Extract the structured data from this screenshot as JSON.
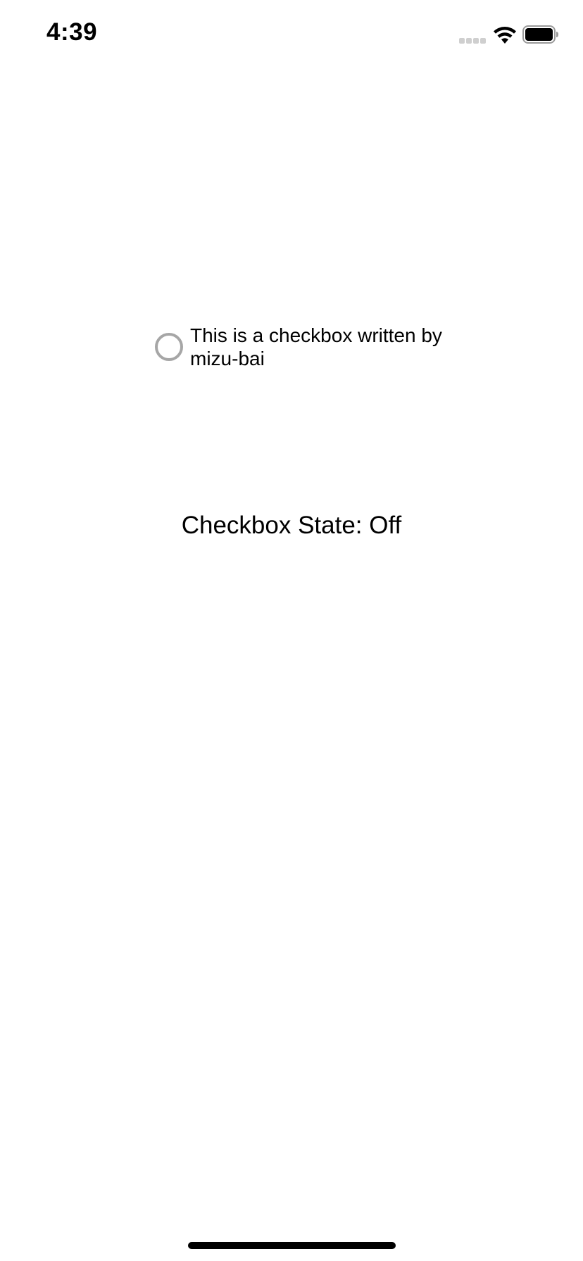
{
  "status_bar": {
    "time": "4:39",
    "icons": {
      "signal": "cellular-signal-icon",
      "wifi": "wifi-icon",
      "battery": "battery-icon"
    }
  },
  "checkbox": {
    "label": "This is a checkbox written by mizu-bai",
    "checked": false,
    "border_color": "#a6a6a6"
  },
  "state": {
    "text": "Checkbox State: Off"
  },
  "colors": {
    "background": "#ffffff",
    "text": "#000000"
  }
}
